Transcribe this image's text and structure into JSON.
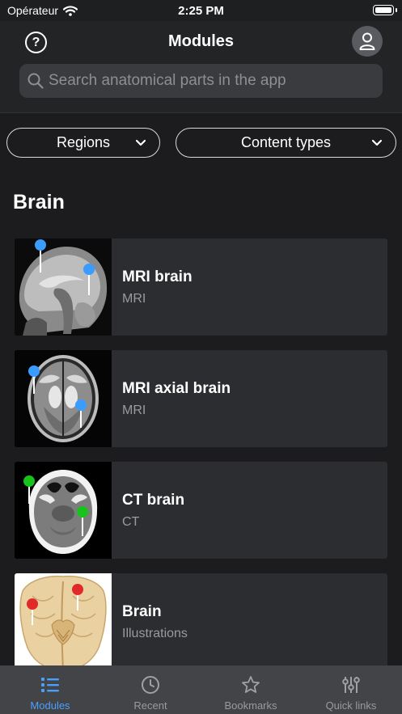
{
  "status_bar": {
    "carrier": "Opérateur",
    "time": "2:25 PM"
  },
  "header": {
    "title": "Modules",
    "help_symbol": "?",
    "search_placeholder": "Search anatomical parts in the app"
  },
  "filters": [
    {
      "label": "Regions"
    },
    {
      "label": "Content types"
    }
  ],
  "section": {
    "title": "Brain"
  },
  "modules": [
    {
      "name": "MRI brain",
      "type": "MRI",
      "pin_color": "#3b9cff",
      "thumb": "mri-sagittal"
    },
    {
      "name": "MRI axial brain",
      "type": "MRI",
      "pin_color": "#3b9cff",
      "thumb": "mri-axial"
    },
    {
      "name": "CT brain",
      "type": "CT",
      "pin_color": "#17c21b",
      "thumb": "ct-axial"
    },
    {
      "name": "Brain",
      "type": "Illustrations",
      "pin_color": "#e02a2a",
      "thumb": "illustration"
    }
  ],
  "tabs": [
    {
      "label": "Modules",
      "icon": "list-icon",
      "active": true
    },
    {
      "label": "Recent",
      "icon": "clock-icon",
      "active": false
    },
    {
      "label": "Bookmarks",
      "icon": "star-icon",
      "active": false
    },
    {
      "label": "Quick links",
      "icon": "sliders-icon",
      "active": false
    }
  ],
  "colors": {
    "accent": "#4aa0ff",
    "background": "#1c1c1e",
    "card": "#2c2d30",
    "tabbar": "#434447"
  }
}
